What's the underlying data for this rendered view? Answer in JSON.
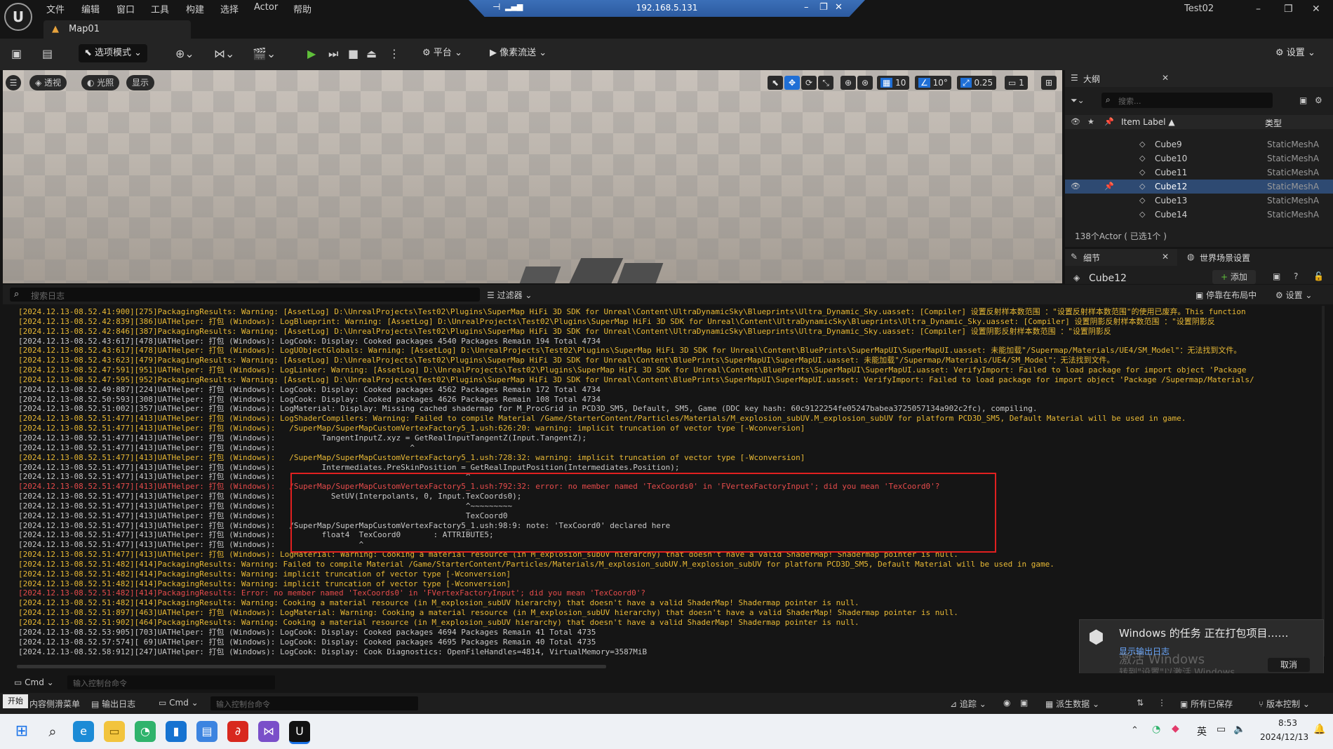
{
  "menu": [
    "文件",
    "编辑",
    "窗口",
    "工具",
    "构建",
    "选择",
    "Actor",
    "帮助"
  ],
  "remote": {
    "ip": "192.168.5.131"
  },
  "project_name": "Test02",
  "tab": {
    "label": "Map01"
  },
  "toolbar": {
    "mode": "选项模式",
    "platform": "平台",
    "pixel_streaming": "像素流送",
    "settings": "设置"
  },
  "viewport": {
    "perspective": "透视",
    "lighting": "光照",
    "show": "显示",
    "grid": "10",
    "angle": "10°",
    "scale": "0.25",
    "camera": "1"
  },
  "outline": {
    "title": "大纲",
    "search_placeholder": "搜索...",
    "col_label": "Item Label ▲",
    "col_type": "类型",
    "items": [
      {
        "name": "Cube9",
        "type": "StaticMeshA"
      },
      {
        "name": "Cube10",
        "type": "StaticMeshA"
      },
      {
        "name": "Cube11",
        "type": "StaticMeshA"
      },
      {
        "name": "Cube12",
        "type": "StaticMeshA"
      },
      {
        "name": "Cube13",
        "type": "StaticMeshA"
      },
      {
        "name": "Cube14",
        "type": "StaticMeshA"
      }
    ],
    "count": "138个Actor ( 已选1个 )"
  },
  "details": {
    "tab": "细节",
    "world_tab": "世界场景设置",
    "selected": "Cube12",
    "add": "添加"
  },
  "log": {
    "search_placeholder": "搜索日志",
    "filter": "过滤器",
    "dock": "停靠在布局中",
    "settings": "设置",
    "lines": [
      "[2024.12.13-08.52.41:900][275]PackagingResults: Warning: [AssetLog] D:\\UnrealProjects\\Test02\\Plugins\\SuperMap HiFi 3D SDK for Unreal\\Content\\UltraDynamicSky\\Blueprints\\Ultra_Dynamic_Sky.uasset: [Compiler] 设置反射样本数范围 ：\"设置反射样本数范围\"的使用已废弃。This function",
      "[2024.12.13-08.52.42:839][386]UATHelper: 打包 (Windows): LogBlueprint: Warning: [AssetLog] D:\\UnrealProjects\\Test02\\Plugins\\SuperMap HiFi 3D SDK for Unreal\\Content\\UltraDynamicSky\\Blueprints\\Ultra_Dynamic_Sky.uasset: [Compiler] 设置阴影反射样本数范围 ：\"设置阴影反",
      "[2024.12.13-08.52.42:846][387]PackagingResults: Warning: [AssetLog] D:\\UnrealProjects\\Test02\\Plugins\\SuperMap HiFi 3D SDK for Unreal\\Content\\UltraDynamicSky\\Blueprints\\Ultra_Dynamic_Sky.uasset: [Compiler] 设置阴影反射样本数范围 ：\"设置阴影反",
      "[2024.12.13-08.52.43:617][478]UATHelper: 打包 (Windows): LogCook: Display: Cooked packages 4540 Packages Remain 194 Total 4734",
      "[2024.12.13-08.52.43:617][478]UATHelper: 打包 (Windows): LogUObjectGlobals: Warning: [AssetLog] D:\\UnrealProjects\\Test02\\Plugins\\SuperMap HiFi 3D SDK for Unreal\\Content\\BluePrints\\SuperMapUI\\SuperMapUI.uasset: 未能加载\"/Supermap/Materials/UE4/SM_Model\"：无法找到文件。",
      "[2024.12.13-08.52.43:623][479]PackagingResults: Warning: [AssetLog] D:\\UnrealProjects\\Test02\\Plugins\\SuperMap HiFi 3D SDK for Unreal\\Content\\BluePrints\\SuperMapUI\\SuperMapUI.uasset: 未能加载\"/Supermap/Materials/UE4/SM_Model\"：无法找到文件。",
      "[2024.12.13-08.52.47:591][951]UATHelper: 打包 (Windows): LogLinker: Warning: [AssetLog] D:\\UnrealProjects\\Test02\\Plugins\\SuperMap HiFi 3D SDK for Unreal\\Content\\BluePrints\\SuperMapUI\\SuperMapUI.uasset: VerifyImport: Failed to load package for import object 'Package",
      "[2024.12.13-08.52.47:595][952]PackagingResults: Warning: [AssetLog] D:\\UnrealProjects\\Test02\\Plugins\\SuperMap HiFi 3D SDK for Unreal\\Content\\BluePrints\\SuperMapUI\\SuperMapUI.uasset: VerifyImport: Failed to load package for import object 'Package /Supermap/Materials/",
      "[2024.12.13-08.52.49:887][224]UATHelper: 打包 (Windows): LogCook: Display: Cooked packages 4562 Packages Remain 172 Total 4734",
      "[2024.12.13-08.52.50:593][308]UATHelper: 打包 (Windows): LogCook: Display: Cooked packages 4626 Packages Remain 108 Total 4734",
      "[2024.12.13-08.52.51:002][357]UATHelper: 打包 (Windows): LogMaterial: Display: Missing cached shadermap for M_ProcGrid in PCD3D_SM5, Default, SM5, Game (DDC key hash: 60c9122254fe05247babea3725057134a902c2fc), compiling.",
      "[2024.12.13-08.52.51:477][413]UATHelper: 打包 (Windows): LogShaderCompilers: Warning: Failed to compile Material /Game/StarterContent/Particles/Materials/M_explosion_subUV.M_explosion_subUV for platform PCD3D_SM5, Default Material will be used in game.",
      "[2024.12.13-08.52.51:477][413]UATHelper: 打包 (Windows):   /SuperMap/SuperMapCustomVertexFactory5_1.ush:626:20: warning: implicit truncation of vector type [-Wconversion]",
      "[2024.12.13-08.52.51:477][413]UATHelper: 打包 (Windows):          TangentInputZ.xyz = GetRealInputTangentZ(Input.TangentZ);",
      "[2024.12.13-08.52.51:477][413]UATHelper: 打包 (Windows):                             ^",
      "[2024.12.13-08.52.51:477][413]UATHelper: 打包 (Windows):   /SuperMap/SuperMapCustomVertexFactory5_1.ush:728:32: warning: implicit truncation of vector type [-Wconversion]",
      "[2024.12.13-08.52.51:477][413]UATHelper: 打包 (Windows):          Intermediates.PreSkinPosition = GetRealInputPosition(Intermediates.Position);",
      "[2024.12.13-08.52.51:477][413]UATHelper: 打包 (Windows):                                         ^",
      "[2024.12.13-08.52.51:477][413]UATHelper: 打包 (Windows):   /SuperMap/SuperMapCustomVertexFactory5_1.ush:792:32: error: no member named 'TexCoords0' in 'FVertexFactoryInput'; did you mean 'TexCoord0'?",
      "[2024.12.13-08.52.51:477][413]UATHelper: 打包 (Windows):            SetUV(Interpolants, 0, Input.TexCoords0);",
      "[2024.12.13-08.52.51:477][413]UATHelper: 打包 (Windows):                                         ^~~~~~~~~~",
      "[2024.12.13-08.52.51:477][413]UATHelper: 打包 (Windows):                                         TexCoord0",
      "[2024.12.13-08.52.51:477][413]UATHelper: 打包 (Windows):   /SuperMap/SuperMapCustomVertexFactory5_1.ush:98:9: note: 'TexCoord0' declared here",
      "[2024.12.13-08.52.51:477][413]UATHelper: 打包 (Windows):          float4  TexCoord0       : ATTRIBUTE5;",
      "[2024.12.13-08.52.51:477][413]UATHelper: 打包 (Windows):                  ^",
      "[2024.12.13-08.52.51:477][413]UATHelper: 打包 (Windows): LogMaterial: Warning: Cooking a material resource (in M_explosion_subUV hierarchy) that doesn't have a valid ShaderMap! Shadermap pointer is null.",
      "[2024.12.13-08.52.51:482][414]PackagingResults: Warning: Failed to compile Material /Game/StarterContent/Particles/Materials/M_explosion_subUV.M_explosion_subUV for platform PCD3D_SM5, Default Material will be used in game.",
      "[2024.12.13-08.52.51:482][414]PackagingResults: Warning: implicit truncation of vector type [-Wconversion]",
      "[2024.12.13-08.52.51:482][414]PackagingResults: Warning: implicit truncation of vector type [-Wconversion]",
      "[2024.12.13-08.52.51:482][414]PackagingResults: Error: no member named 'TexCoords0' in 'FVertexFactoryInput'; did you mean 'TexCoord0'?",
      "[2024.12.13-08.52.51:482][414]PackagingResults: Warning: Cooking a material resource (in M_explosion_subUV hierarchy) that doesn't have a valid ShaderMap! Shadermap pointer is null.",
      "[2024.12.13-08.52.51:897][463]UATHelper: 打包 (Windows): LogMaterial: Warning: Cooking a material resource (in M_explosion_subUV hierarchy) that doesn't have a valid ShaderMap! Shadermap pointer is null.",
      "[2024.12.13-08.52.51:902][464]PackagingResults: Warning: Cooking a material resource (in M_explosion_subUV hierarchy) that doesn't have a valid ShaderMap! Shadermap pointer is null.",
      "[2024.12.13-08.52.53:905][703]UATHelper: 打包 (Windows): LogCook: Display: Cooked packages 4694 Packages Remain 41 Total 4735",
      "[2024.12.13-08.52.57:574][ 69]UATHelper: 打包 (Windows): LogCook: Display: Cooked packages 4695 Packages Remain 40 Total 4735",
      "[2024.12.13-08.52.58:912][247]UATHelper: 打包 (Windows): LogCook: Display: Cook Diagnostics: OpenFileHandles=4814, VirtualMemory=3587MiB"
    ],
    "line_levels": [
      "warn",
      "warn",
      "warn",
      "n",
      "warn",
      "warn",
      "warn",
      "warn",
      "n",
      "n",
      "n",
      "warn",
      "warn",
      "n",
      "n",
      "warn",
      "n",
      "n",
      "err",
      "n",
      "n",
      "n",
      "n",
      "n",
      "n",
      "warn",
      "warn",
      "warn",
      "warn",
      "err",
      "warn",
      "warn",
      "warn",
      "n",
      "n",
      "n"
    ]
  },
  "cmd": {
    "label": "Cmd",
    "placeholder": "输入控制台命令"
  },
  "statusbar": {
    "content_drawer": "内容侧滑菜单",
    "output_log": "输出日志",
    "cmd": "Cmd",
    "cmd_placeholder": "输入控制台命令",
    "trace": "追踪",
    "derived_data": "派生数据",
    "all_saved": "所有已保存",
    "version_control": "版本控制",
    "start": "开始"
  },
  "toast": {
    "title": "Windows 的任务 正在打包项目……",
    "sub": "显示输出日志",
    "watermark1": "激活 Windows",
    "watermark2": "转到\"设置\"以激活 Windows。",
    "cancel": "取消"
  },
  "taskbar": {
    "ime": "英",
    "time": "8:53",
    "date": "2024/12/13"
  },
  "colors": {
    "accent": "#1f6fd6",
    "warning": "#e8b935",
    "error": "#e64b4b",
    "highlight_box": "#e02020"
  }
}
